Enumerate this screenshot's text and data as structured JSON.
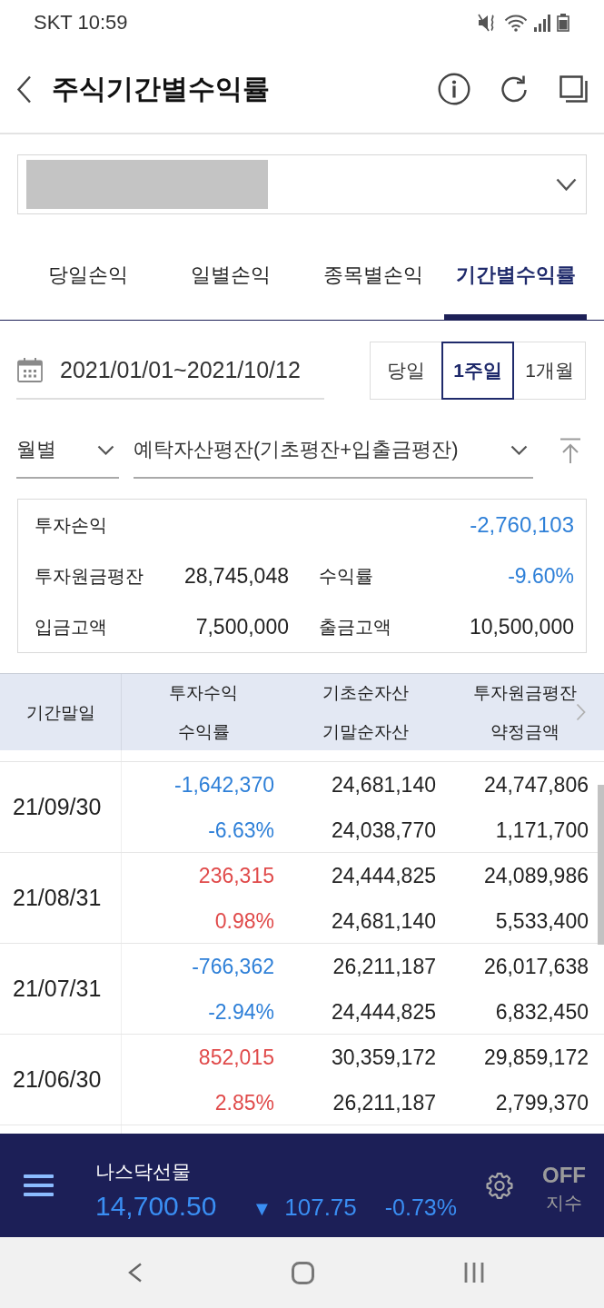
{
  "status_bar": {
    "text": "SKT 10:59"
  },
  "header": {
    "title": "주식기간별수익률"
  },
  "account_select": {
    "masked": true
  },
  "tabs": [
    {
      "label": "당일손익",
      "selected": false
    },
    {
      "label": "일별손익",
      "selected": false
    },
    {
      "label": "종목별손익",
      "selected": false
    },
    {
      "label": "기간별수익률",
      "selected": true
    }
  ],
  "date_range": {
    "value": "2021/01/01~2021/10/12"
  },
  "period_buttons": [
    {
      "label": "당일",
      "selected": false
    },
    {
      "label": "1주일",
      "selected": true
    },
    {
      "label": "1개월",
      "selected": false
    }
  ],
  "filters": [
    {
      "value": "월별"
    },
    {
      "value": "예탁자산평잔(기초평잔+입출금평잔)"
    }
  ],
  "summary": {
    "rows": [
      [
        {
          "label": "투자손익",
          "value": "-2,760,103",
          "color": "#2f80d8"
        }
      ],
      [
        {
          "label": "투자원금평잔",
          "value": "28,745,048",
          "color": "#222222"
        },
        {
          "label": "수익률",
          "value": "-9.60%",
          "color": "#2f80d8"
        }
      ],
      [
        {
          "label": "입금고액",
          "value": "7,500,000",
          "color": "#222222"
        },
        {
          "label": "출금고액",
          "value": "10,500,000",
          "color": "#222222"
        }
      ]
    ]
  },
  "table": {
    "columns": [
      [
        "기간말일"
      ],
      [
        "투자수익",
        "수익률"
      ],
      [
        "기초순자산",
        "기말순자산"
      ],
      [
        "투자원금평잔",
        "약정금액"
      ]
    ],
    "rows": [
      {
        "date": "21/09/30",
        "color": "#2f80d8",
        "values": [
          [
            "-1,642,370",
            "-6.63%"
          ],
          [
            "24,681,140",
            "24,038,770"
          ],
          [
            "24,747,806",
            "1,171,700"
          ]
        ]
      },
      {
        "date": "21/08/31",
        "color": "#e04a4a",
        "values": [
          [
            "236,315",
            "0.98%"
          ],
          [
            "24,444,825",
            "24,681,140"
          ],
          [
            "24,089,986",
            "5,533,400"
          ]
        ]
      },
      {
        "date": "21/07/31",
        "color": "#2f80d8",
        "values": [
          [
            "-766,362",
            "-2.94%"
          ],
          [
            "26,211,187",
            "24,444,825"
          ],
          [
            "26,017,638",
            "6,832,450"
          ]
        ]
      },
      {
        "date": "21/06/30",
        "color": "#e04a4a",
        "values": [
          [
            "852,015",
            "2.85%"
          ],
          [
            "30,359,172",
            "26,211,187"
          ],
          [
            "29,859,172",
            "2,799,370"
          ]
        ]
      }
    ]
  },
  "ticker": {
    "name": "나스닥선물",
    "price": "14,700.50",
    "color": "#3a8ef3",
    "arrow": "▼",
    "change": "107.75",
    "change_rate": "-0.73%",
    "toggle": {
      "label": "OFF",
      "caption": "지수"
    }
  }
}
